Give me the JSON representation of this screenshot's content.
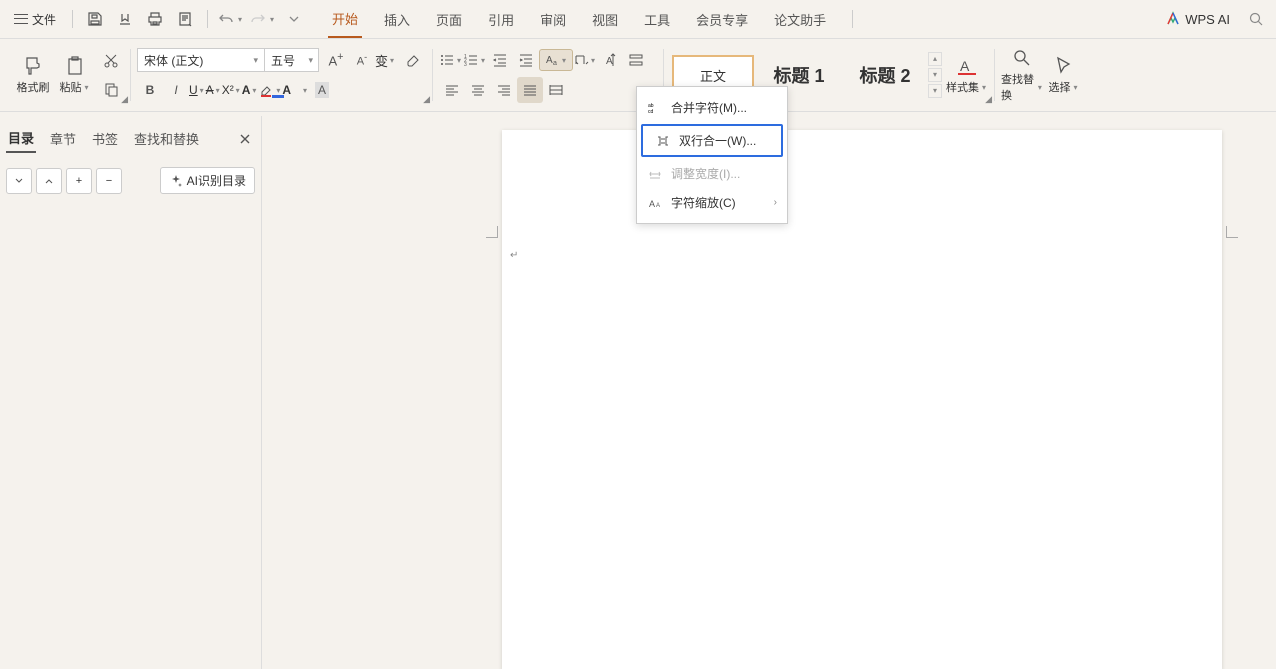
{
  "menu": {
    "file": "文件",
    "tabs": [
      "开始",
      "插入",
      "页面",
      "引用",
      "审阅",
      "视图",
      "工具",
      "会员专享",
      "论文助手"
    ],
    "active_tab_index": 0,
    "wps_ai": "WPS AI"
  },
  "ribbon": {
    "format_painter": "格式刷",
    "paste": "粘贴",
    "font_name": "宋体 (正文)",
    "font_size": "五号",
    "styles": {
      "body": "正文",
      "h1": "标题 1",
      "h2": "标题 2"
    },
    "style_set": "样式集",
    "find_replace": "查找替换",
    "select": "选择"
  },
  "dropdown": {
    "merge_chars": "合并字符(M)...",
    "two_line": "双行合一(W)...",
    "adjust_width": "调整宽度(I)...",
    "char_scale": "字符缩放(C)"
  },
  "panel": {
    "tabs": [
      "目录",
      "章节",
      "书签",
      "查找和替换"
    ],
    "active_tab_index": 0,
    "ai_toc": "AI识别目录"
  }
}
